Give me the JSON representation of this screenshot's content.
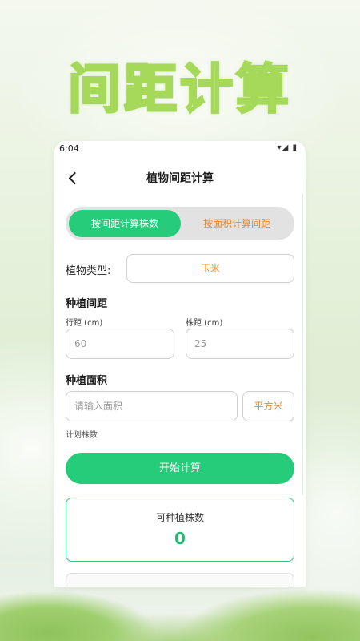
{
  "promo": {
    "headline": "间距计算"
  },
  "status_bar": {
    "time": "6:04",
    "icons": "▾◢ ▮"
  },
  "header": {
    "back_icon": "chevron-left-icon",
    "title": "植物间距计算"
  },
  "mode_tabs": [
    {
      "label": "按间距计算株数",
      "active": true
    },
    {
      "label": "按面积计算间距",
      "active": false
    }
  ],
  "plant_type": {
    "label": "植物类型:",
    "value": "玉米"
  },
  "spacing": {
    "section_title": "种植间距",
    "row_label": "行距 (cm)",
    "row_value": "60",
    "plant_label": "株距 (cm)",
    "plant_value": "25"
  },
  "area": {
    "section_title": "种植面积",
    "placeholder": "请输入面积",
    "unit": "平方米",
    "plan_label": "计划株数"
  },
  "actions": {
    "start_label": "开始计算"
  },
  "result": {
    "label": "可种植株数",
    "value": "0"
  },
  "colors": {
    "accent": "#25cc7a",
    "orange": "#e28a36",
    "headline_stroke": "#a6d95a"
  }
}
